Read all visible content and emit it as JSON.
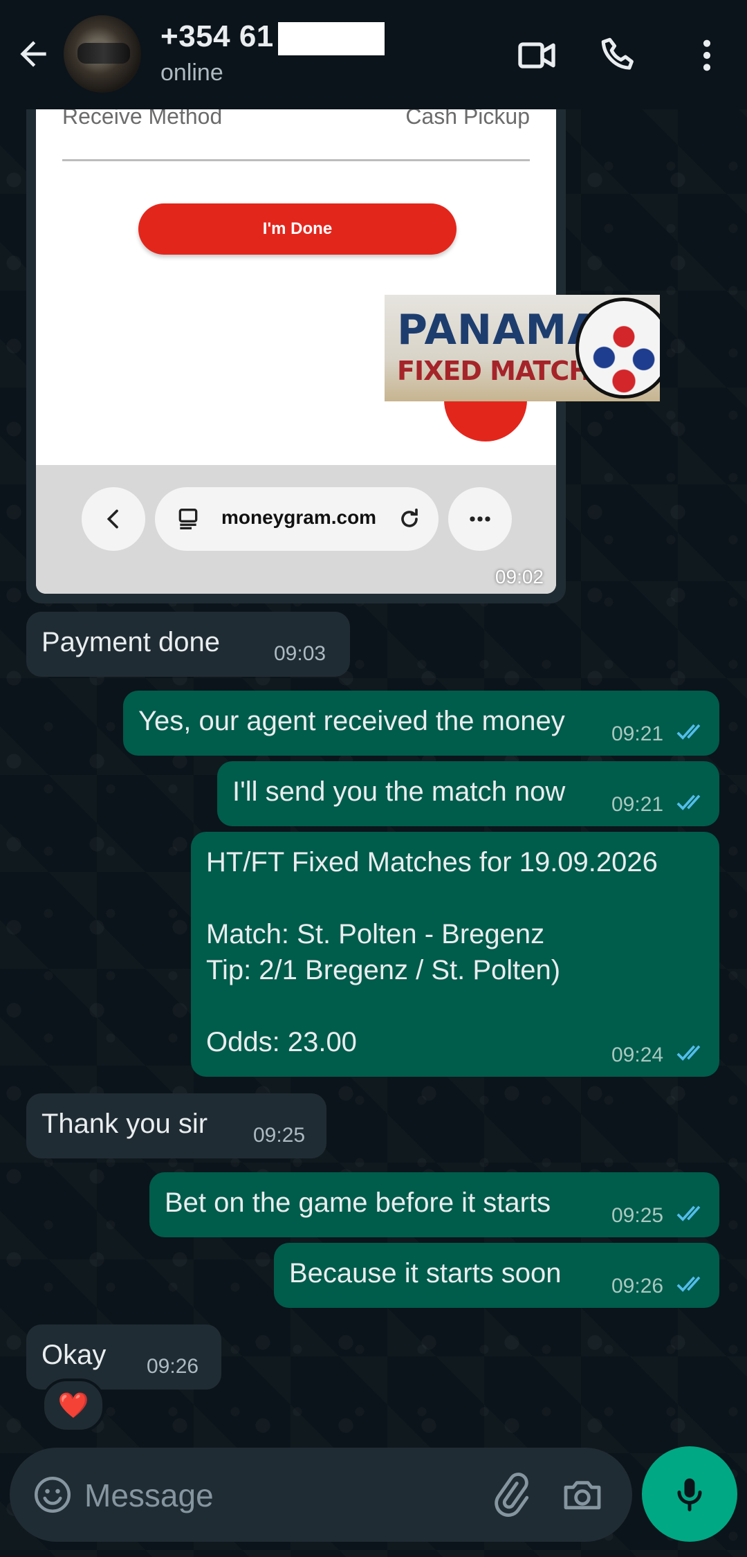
{
  "header": {
    "contact_name": "+354 61",
    "status": "online"
  },
  "shared_image": {
    "receive_label": "Receive Method",
    "receive_value": "Cash Pickup",
    "done_button": "I'm Done",
    "url": "moneygram.com",
    "time": "09:02"
  },
  "banner": {
    "line1": "PANAMA",
    "line2": "FIXED MATCHES"
  },
  "messages": [
    {
      "dir": "in",
      "text": "Payment done",
      "time": "09:03"
    },
    {
      "dir": "out",
      "text": "Yes, our agent received the money",
      "time": "09:21"
    },
    {
      "dir": "out",
      "text": "I'll send you the match now",
      "time": "09:21"
    },
    {
      "dir": "out",
      "text": "HT/FT Fixed Matches for 19.09.2026\n\nMatch: St. Polten - Bregenz\nTip: 2/1 Bregenz / St. Polten)\n\nOdds: 23.00",
      "time": "09:24"
    },
    {
      "dir": "in",
      "text": "Thank you sir",
      "time": "09:25"
    },
    {
      "dir": "out",
      "text": "Bet on the game before it starts",
      "time": "09:25"
    },
    {
      "dir": "out",
      "text": "Because it starts soon",
      "time": "09:26"
    },
    {
      "dir": "in",
      "text": "Okay",
      "time": "09:26"
    }
  ],
  "reaction": "❤️",
  "input": {
    "placeholder": "Message"
  },
  "colors": {
    "background": "#0b141a",
    "incoming_bubble": "#202c33",
    "outgoing_bubble": "#005c4b",
    "read_ticks": "#53bdeb",
    "mic_button": "#00a884"
  },
  "icons": [
    "back-arrow-icon",
    "video-call-icon",
    "phone-icon",
    "more-vert-icon",
    "emoji-icon",
    "attach-icon",
    "camera-icon",
    "mic-icon"
  ]
}
